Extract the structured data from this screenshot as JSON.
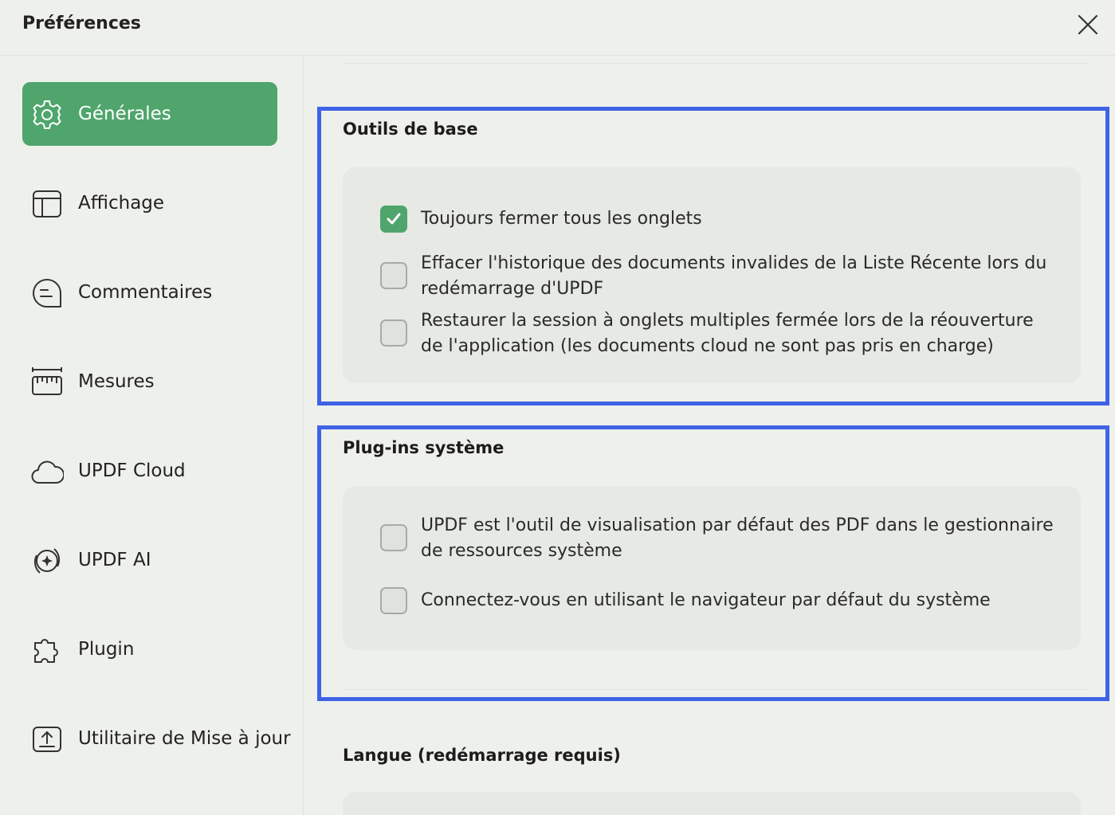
{
  "window": {
    "title": "Préférences"
  },
  "sidebar": {
    "items": [
      {
        "label": "Générales",
        "icon": "gear-icon",
        "active": true
      },
      {
        "label": "Affichage",
        "icon": "layout-icon",
        "active": false
      },
      {
        "label": "Commentaires",
        "icon": "comment-icon",
        "active": false
      },
      {
        "label": "Mesures",
        "icon": "ruler-icon",
        "active": false
      },
      {
        "label": "UPDF Cloud",
        "icon": "cloud-icon",
        "active": false
      },
      {
        "label": "UPDF AI",
        "icon": "ai-sparkle-icon",
        "active": false
      },
      {
        "label": "Plugin",
        "icon": "puzzle-icon",
        "active": false
      },
      {
        "label": "Utilitaire de Mise à jour",
        "icon": "upload-icon",
        "active": false
      }
    ]
  },
  "sections": {
    "basic_tools": {
      "title": "Outils de base",
      "options": [
        {
          "label": "Toujours fermer tous les onglets",
          "checked": true
        },
        {
          "label": "Effacer l'historique des documents invalides de la Liste Récente lors du redémarrage d'UPDF",
          "checked": false
        },
        {
          "label": "Restaurer la session à onglets multiples fermée lors de la réouverture de l'application (les documents cloud ne sont pas pris en charge)",
          "checked": false
        }
      ]
    },
    "system_plugins": {
      "title": "Plug-ins système",
      "options": [
        {
          "label": "UPDF est l'outil de visualisation par défaut des PDF dans le gestionnaire de ressources système",
          "checked": false
        },
        {
          "label": "Connectez-vous en utilisant le navigateur par défaut du système",
          "checked": false
        }
      ]
    },
    "language": {
      "title": "Langue (redémarrage requis)"
    }
  },
  "colors": {
    "accent": "#4fa56c",
    "highlight_border": "#3f63e6",
    "background": "#eef0ec",
    "panel": "#e6e9e4"
  }
}
